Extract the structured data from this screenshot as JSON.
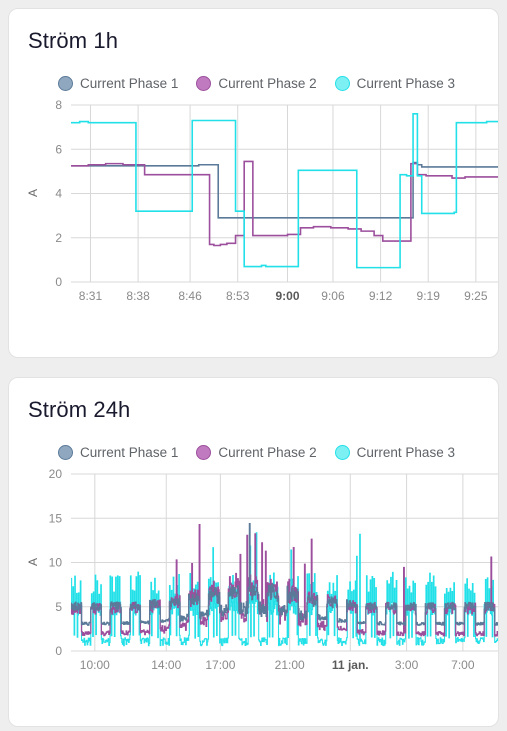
{
  "page": {
    "background": "#eeeeee"
  },
  "colors": {
    "phase1": "#5b7a99",
    "phase1_fill": "#8fa8bf",
    "phase2": "#9c4f9c",
    "phase2_fill": "#c07bc0",
    "phase3": "#22e0e8",
    "phase3_fill": "#7df0f4",
    "grid": "#d8d8d8",
    "tick": "#8a8a8a",
    "tick_bold": "#5a5a5a",
    "title": "#1a1a2e",
    "legend_label": "#5f6368",
    "card_bg": "#ffffff",
    "card_border": "#e2e2e2"
  },
  "legend": {
    "items": [
      {
        "label": "Current Phase 1",
        "color_key": "phase1",
        "dot_icon": "legend-dot-icon"
      },
      {
        "label": "Current Phase 2",
        "color_key": "phase2",
        "dot_icon": "legend-dot-icon"
      },
      {
        "label": "Current Phase 3",
        "color_key": "phase3",
        "dot_icon": "legend-dot-icon"
      }
    ]
  },
  "cards": [
    {
      "title": "Ström 1h"
    },
    {
      "title": "Ström 24h"
    }
  ],
  "chart_data": [
    {
      "type": "line",
      "title": "Ström 1h",
      "xlabel": "",
      "ylabel": "A",
      "ylim": [
        0,
        8
      ],
      "yticks": [
        0,
        2,
        4,
        6,
        8
      ],
      "ytick_labels": [
        "0",
        "2",
        "4",
        "6",
        "8"
      ],
      "xticks": [
        "8:31",
        "8:38",
        "8:46",
        "8:53",
        "9:00",
        "9:06",
        "9:12",
        "9:19",
        "9:25"
      ],
      "xtick_bold_index": 4,
      "xtick_positions": [
        0.045,
        0.155,
        0.275,
        0.385,
        0.5,
        0.605,
        0.715,
        0.825,
        0.935
      ],
      "grid": true,
      "legend_position": "top-center",
      "series": [
        {
          "name": "Current Phase 1",
          "color_key": "phase1",
          "x": [
            0.0,
            0.05,
            0.1,
            0.15,
            0.2,
            0.25,
            0.295,
            0.305,
            0.32,
            0.34,
            0.36,
            0.38,
            0.4,
            0.45,
            0.5,
            0.55,
            0.6,
            0.65,
            0.7,
            0.75,
            0.775,
            0.79,
            0.8,
            0.81,
            0.83,
            0.85,
            0.88,
            0.92,
            0.96,
            1.0
          ],
          "y": [
            5.25,
            5.25,
            5.25,
            5.25,
            5.25,
            5.25,
            5.3,
            5.3,
            5.3,
            2.9,
            2.9,
            2.9,
            2.9,
            2.9,
            2.9,
            2.9,
            2.9,
            2.9,
            2.9,
            2.9,
            2.9,
            5.4,
            5.3,
            5.2,
            5.2,
            5.2,
            5.2,
            5.2,
            5.2,
            5.2
          ]
        },
        {
          "name": "Current Phase 2",
          "color_key": "phase2",
          "x": [
            0.0,
            0.04,
            0.08,
            0.12,
            0.155,
            0.17,
            0.2,
            0.25,
            0.295,
            0.31,
            0.32,
            0.33,
            0.345,
            0.36,
            0.38,
            0.4,
            0.42,
            0.44,
            0.46,
            0.5,
            0.53,
            0.56,
            0.6,
            0.64,
            0.67,
            0.7,
            0.72,
            0.74,
            0.77,
            0.785,
            0.8,
            0.82,
            0.85,
            0.88,
            0.91,
            0.94,
            1.0
          ],
          "y": [
            5.25,
            5.3,
            5.35,
            5.3,
            5.3,
            4.85,
            4.85,
            4.85,
            4.85,
            4.85,
            1.7,
            1.65,
            1.7,
            1.75,
            2.1,
            5.45,
            2.1,
            2.1,
            2.1,
            2.15,
            2.45,
            2.5,
            2.45,
            2.4,
            2.3,
            2.1,
            1.85,
            1.85,
            1.85,
            5.35,
            4.85,
            4.8,
            4.8,
            4.7,
            4.75,
            4.75,
            4.75
          ]
        },
        {
          "name": "Current Phase 3",
          "color_key": "phase3",
          "x": [
            0.0,
            0.02,
            0.04,
            0.1,
            0.145,
            0.15,
            0.2,
            0.25,
            0.275,
            0.28,
            0.32,
            0.36,
            0.375,
            0.38,
            0.395,
            0.4,
            0.42,
            0.44,
            0.45,
            0.455,
            0.5,
            0.52,
            0.525,
            0.53,
            0.58,
            0.62,
            0.655,
            0.66,
            0.7,
            0.715,
            0.72,
            0.76,
            0.775,
            0.78,
            0.785,
            0.79,
            0.8,
            0.81,
            0.85,
            0.88,
            0.885,
            0.89,
            0.93,
            0.96,
            1.0
          ],
          "y": [
            7.2,
            7.25,
            7.2,
            7.2,
            7.2,
            3.2,
            3.2,
            3.2,
            3.2,
            7.3,
            7.3,
            7.3,
            7.3,
            3.2,
            3.2,
            0.7,
            0.7,
            0.75,
            0.7,
            0.7,
            0.7,
            0.7,
            5.05,
            5.05,
            5.05,
            5.05,
            5.05,
            0.65,
            0.65,
            0.65,
            0.65,
            4.85,
            4.8,
            4.8,
            4.8,
            7.6,
            4.8,
            3.1,
            3.1,
            3.1,
            3.15,
            7.2,
            7.2,
            7.25,
            7.2
          ]
        }
      ]
    },
    {
      "type": "line",
      "title": "Ström 24h",
      "xlabel": "",
      "ylabel": "A",
      "ylim": [
        0,
        20
      ],
      "yticks": [
        0,
        5,
        10,
        15,
        20
      ],
      "ytick_labels": [
        "0",
        "5",
        "10",
        "15",
        "20"
      ],
      "xticks": [
        "10:00",
        "14:00",
        "17:00",
        "21:00",
        "11 jan.",
        "3:00",
        "7:00"
      ],
      "xtick_bold_index": 4,
      "xtick_positions": [
        0.055,
        0.22,
        0.345,
        0.505,
        0.645,
        0.775,
        0.905
      ],
      "grid": true,
      "legend_position": "top-center",
      "note": "dense oscillating 24h current trace, 3 phases; phase3 spikes to ~15, phase2 spikes to ~14.3, phase1 spike to ~15",
      "series": [
        {
          "name": "Current Phase 1",
          "color_key": "phase1",
          "baseline": 2.9,
          "peak": 15.0,
          "typical_range": [
            2.6,
            5.5
          ]
        },
        {
          "name": "Current Phase 2",
          "color_key": "phase2",
          "baseline": 1.7,
          "peak": 14.3,
          "typical_range": [
            1.5,
            5.2
          ]
        },
        {
          "name": "Current Phase 3",
          "color_key": "phase3",
          "baseline": 0.7,
          "peak": 15.0,
          "typical_range": [
            0.6,
            8.2
          ]
        }
      ]
    }
  ]
}
